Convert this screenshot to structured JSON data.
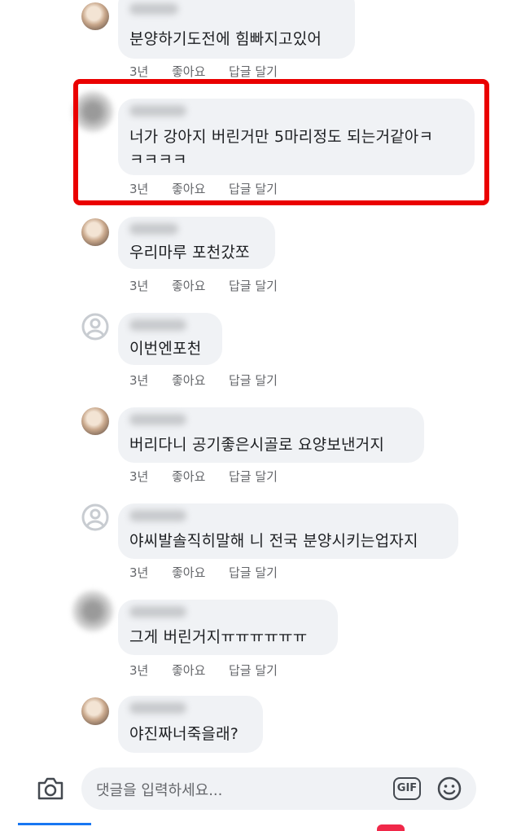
{
  "comments": [
    {
      "text": "분양하기도전에 힘빠지고있어",
      "time": "3년",
      "like": "좋아요",
      "reply": "답글 달기"
    },
    {
      "text1": "너가 강아지 버린거만 5마리정도 되는거같아ㅋ",
      "text2": "ㅋㅋㅋㅋ",
      "time": "3년",
      "like": "좋아요",
      "reply": "답글 달기"
    },
    {
      "text": "우리마루 포천갔쪼",
      "time": "3년",
      "like": "좋아요",
      "reply": "답글 달기"
    },
    {
      "text": "이번엔포천",
      "time": "3년",
      "like": "좋아요",
      "reply": "답글 달기"
    },
    {
      "text": "버리다니 공기좋은시골로 요양보낸거지",
      "time": "3년",
      "like": "좋아요",
      "reply": "답글 달기"
    },
    {
      "text": "야씨발솔직히말해 니 전국 분양시키는업자지",
      "time": "3년",
      "like": "좋아요",
      "reply": "답글 달기"
    },
    {
      "text": "그게 버린거지ㅠㅠㅠㅠㅠㅠ",
      "time": "3년",
      "like": "좋아요",
      "reply": "답글 달기"
    },
    {
      "text": "야진짜너죽을래?",
      "time": "",
      "like": "",
      "reply": ""
    }
  ],
  "input": {
    "placeholder": "댓글을 입력하세요...",
    "gif_label": "GIF",
    "camera_icon": "camera-icon",
    "emoji_icon": "smiley-icon"
  },
  "colors": {
    "highlight": "#ea0000",
    "bubble": "#f0f2f5",
    "meta_text": "#65676b",
    "tab_accent": "#1877f2"
  }
}
